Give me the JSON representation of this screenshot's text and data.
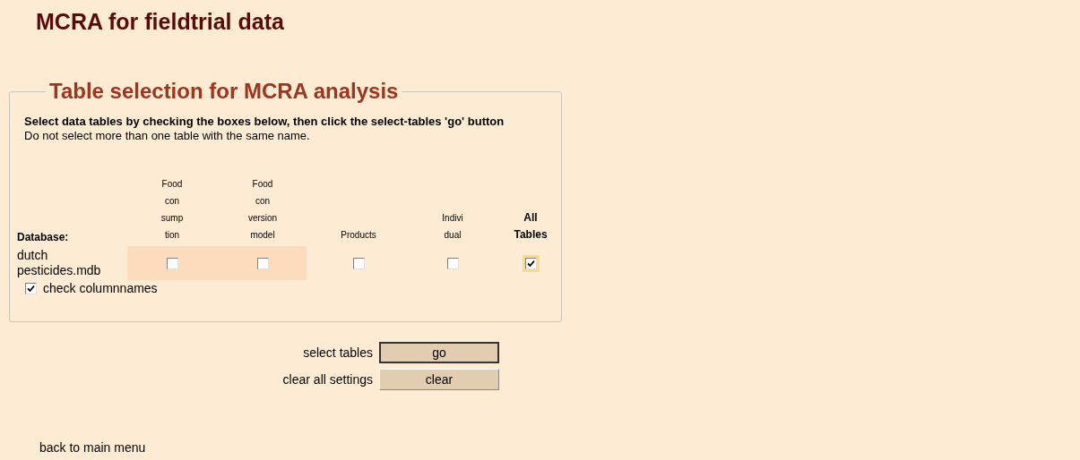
{
  "title": "MCRA for fieldtrial data",
  "fieldset": {
    "legend": "Table selection for MCRA analysis",
    "instruction": "Select data tables by checking the boxes below, then click the select-tables 'go' button",
    "note": "Do not select more than one table with the same name.",
    "database_header": "Database:",
    "columns": [
      {
        "lines": [
          "Food",
          "con",
          "sump",
          "tion"
        ],
        "bold": false
      },
      {
        "lines": [
          "Food",
          "con",
          "version",
          "model"
        ],
        "bold": false
      },
      {
        "lines": [
          "Products"
        ],
        "bold": false
      },
      {
        "lines": [
          "Indivi",
          "dual"
        ],
        "bold": false
      },
      {
        "lines": [
          "All",
          "Tables"
        ],
        "bold": true
      }
    ],
    "rows": [
      {
        "database": [
          "dutch",
          "pesticides.mdb"
        ],
        "cells": [
          {
            "checked": false,
            "focused": false
          },
          {
            "checked": false,
            "focused": false
          },
          {
            "checked": false,
            "focused": false
          },
          {
            "checked": false,
            "focused": false
          },
          {
            "checked": true,
            "focused": true
          }
        ]
      }
    ],
    "check_columnnames": {
      "label": "check columnnames",
      "checked": true
    }
  },
  "actions": [
    {
      "label": "select tables",
      "button": "go",
      "default": true
    },
    {
      "label": "clear all settings",
      "button": "clear",
      "default": false
    }
  ],
  "back_link": "back to main menu"
}
